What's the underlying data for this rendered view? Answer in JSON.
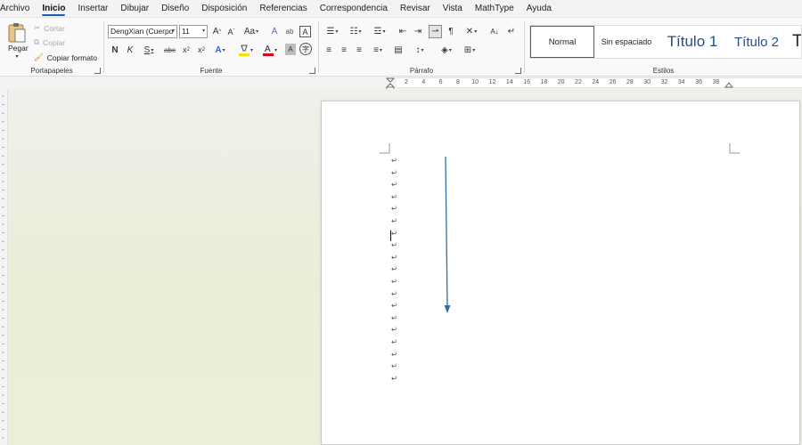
{
  "menu": {
    "tabs": [
      "Archivo",
      "Inicio",
      "Insertar",
      "Dibujar",
      "Diseño",
      "Disposición",
      "Referencias",
      "Correspondencia",
      "Revisar",
      "Vista",
      "MathType",
      "Ayuda"
    ],
    "active": "Inicio"
  },
  "clipboard": {
    "paste_label": "Pegar",
    "cut_label": "Cortar",
    "copy_label": "Copiar",
    "format_painter_label": "Copiar formato",
    "group_label": "Portapapeles"
  },
  "font": {
    "name": "DengXian (Cuerpo",
    "size": "11",
    "bold_label": "N",
    "italic_label": "K",
    "underline_label": "S",
    "strike_label": "abc",
    "group_label": "Fuente",
    "highlight_color": "#f5e100",
    "font_color": "#e0001b"
  },
  "paragraph": {
    "group_label": "Párrafo"
  },
  "styles": {
    "group_label": "Estilos",
    "items": [
      "Normal",
      "Sin espaciado",
      "Título 1",
      "Título 2",
      "T"
    ]
  },
  "ruler": {
    "labels": [
      "2",
      "4",
      "6",
      "8",
      "10",
      "12",
      "14",
      "16",
      "18",
      "20",
      "22",
      "24",
      "26",
      "28",
      "30",
      "32",
      "34",
      "36",
      "38"
    ]
  },
  "document": {
    "paragraph_mark": "↵",
    "paragraph_count": 19,
    "arrow_color": "#2f6fa8",
    "accent": "#185abd"
  }
}
